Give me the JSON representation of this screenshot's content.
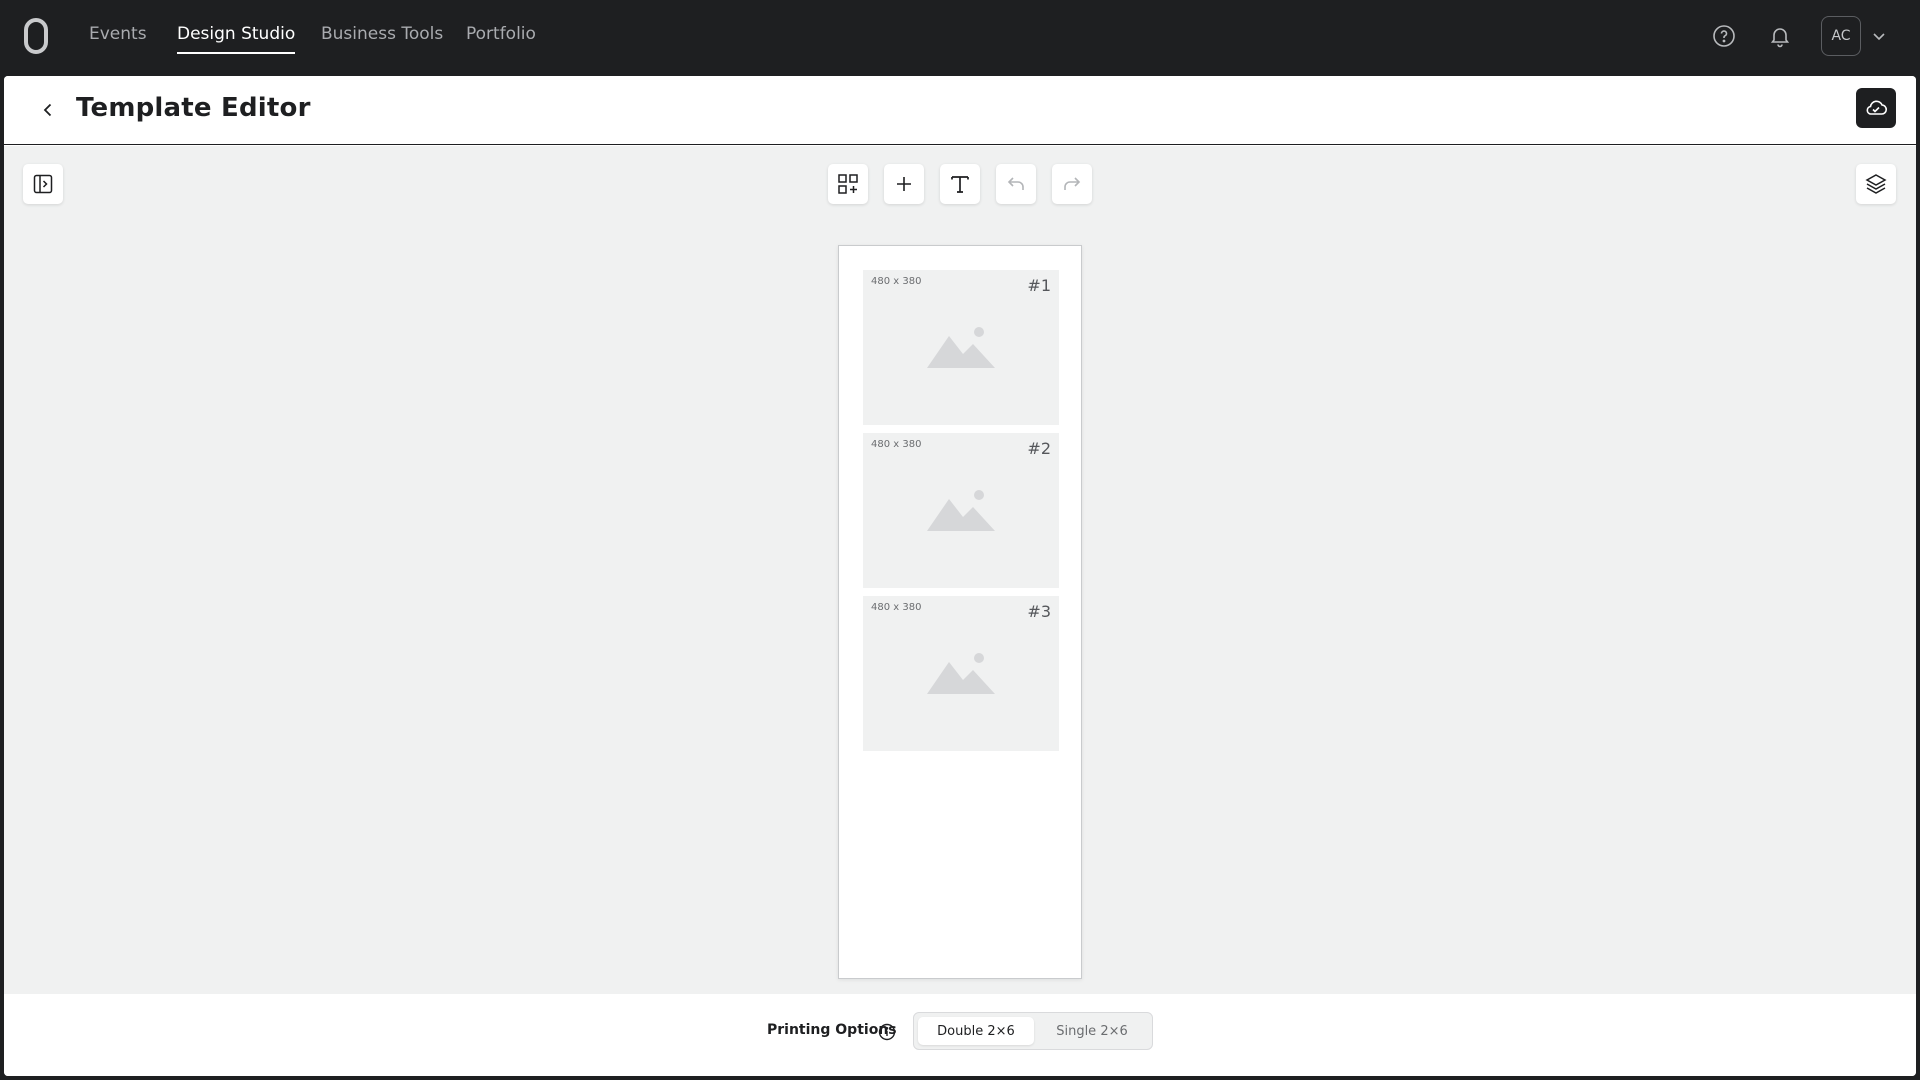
{
  "nav": {
    "items": [
      {
        "label": "Events",
        "active": false
      },
      {
        "label": "Design Studio",
        "active": true
      },
      {
        "label": "Business Tools",
        "active": false
      },
      {
        "label": "Portfolio",
        "active": false
      }
    ],
    "avatar_initials": "AC",
    "icons": [
      "logo-icon",
      "help-icon",
      "bell-icon",
      "chevron-down-icon"
    ]
  },
  "header": {
    "title": "Template Editor",
    "back_icon": "chevron-left-icon",
    "save_icon": "cloud-icon"
  },
  "toolbar": {
    "icons": [
      "sidebar-toggle-icon",
      "add-grid-icon",
      "plus-icon",
      "text-icon",
      "undo-icon",
      "redo-icon",
      "layers-icon"
    ]
  },
  "canvas": {
    "slots": [
      {
        "size": "480 x 380",
        "number": "#1"
      },
      {
        "size": "480 x 380",
        "number": "#2"
      },
      {
        "size": "480 x 380",
        "number": "#3"
      }
    ]
  },
  "footer": {
    "printing_label": "Printing Options",
    "options": [
      {
        "label": "Double 2×6",
        "selected": true
      },
      {
        "label": "Single 2×6",
        "selected": false
      }
    ]
  },
  "colors": {
    "nav_bg": "#1e1f21",
    "workspace_bg": "#f0f1f1",
    "accent_dark": "#1e1f21"
  }
}
